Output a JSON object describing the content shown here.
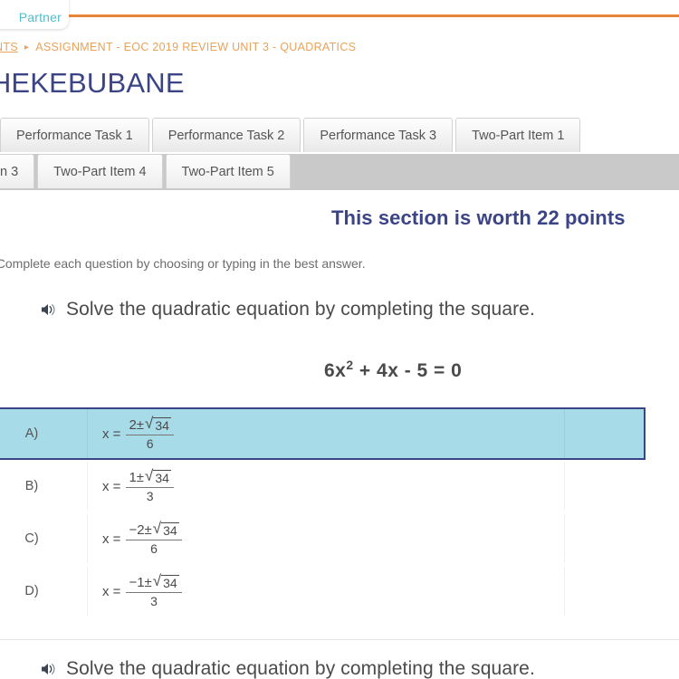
{
  "browser": {
    "partner_tab_label": "Partner"
  },
  "breadcrumb": {
    "parent_label": "NTS",
    "separator": "▸",
    "current_label": "ASSIGNMENT - EOC 2019 REVIEW UNIT 3 - QUADRATICS"
  },
  "page": {
    "title": "ent - HEKEBUBANE"
  },
  "tabs": {
    "row1": [
      {
        "label": "Performance Task 1",
        "selected": false
      },
      {
        "label": "Performance Task 2",
        "selected": false
      },
      {
        "label": "Performance Task 3",
        "selected": false
      },
      {
        "label": "Two-Part Item 1",
        "selected": false
      }
    ],
    "row2": [
      {
        "label": "n 3",
        "selected": false,
        "clipped": true
      },
      {
        "label": "Two-Part Item 4",
        "selected": false
      },
      {
        "label": "Two-Part Item 5",
        "selected": false
      }
    ]
  },
  "section": {
    "worth_heading": "This section is worth 22 points",
    "directions": ": Complete each question by choosing or typing in the best answer."
  },
  "questions": [
    {
      "audio_icon": "speaker-icon",
      "prompt": "Solve the quadratic equation by completing the square.",
      "equation": {
        "lead": "6x",
        "exponent": "2",
        "rest": " + 4x - 5 = 0"
      },
      "options": [
        {
          "letter": "A)",
          "lhs": "x =",
          "numerator_prefix": "2±",
          "radicand": "34",
          "denominator": "6",
          "selected": true
        },
        {
          "letter": "B)",
          "lhs": "x =",
          "numerator_prefix": "1±",
          "radicand": "34",
          "denominator": "3",
          "selected": false
        },
        {
          "letter": "C)",
          "lhs": "x =",
          "numerator_prefix": "−2±",
          "radicand": "34",
          "denominator": "6",
          "selected": false
        },
        {
          "letter": "D)",
          "lhs": "x =",
          "numerator_prefix": "−1±",
          "radicand": "34",
          "denominator": "3",
          "selected": false
        }
      ]
    },
    {
      "audio_icon": "speaker-icon",
      "prompt": "Solve the quadratic equation by completing the square."
    }
  ],
  "colors": {
    "accent_orange": "#e8833a",
    "title_navy": "#3b4486",
    "selected_fill": "#a8dbe8",
    "partner_teal": "#55bcc9"
  },
  "symbols": {
    "radical": "√"
  }
}
